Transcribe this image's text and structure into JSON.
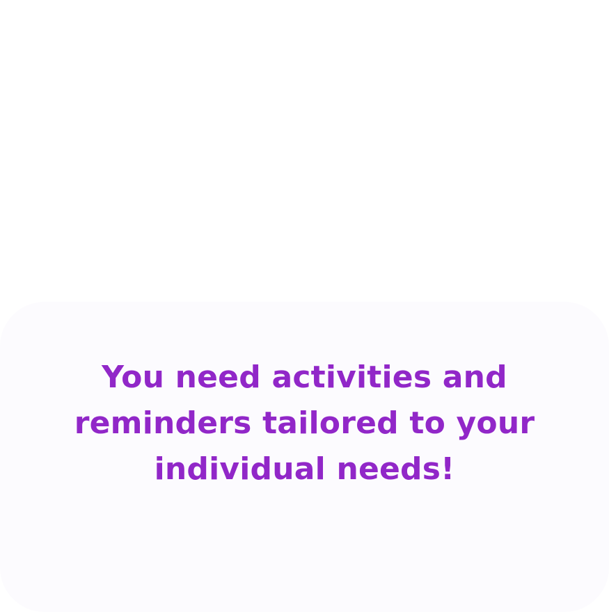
{
  "colors": {
    "background": "#ffffff",
    "card_background": "#fcfbfe",
    "accent_text": "#9127c8"
  },
  "card": {
    "message": "You need activities and reminders tailored to your individual needs!"
  }
}
